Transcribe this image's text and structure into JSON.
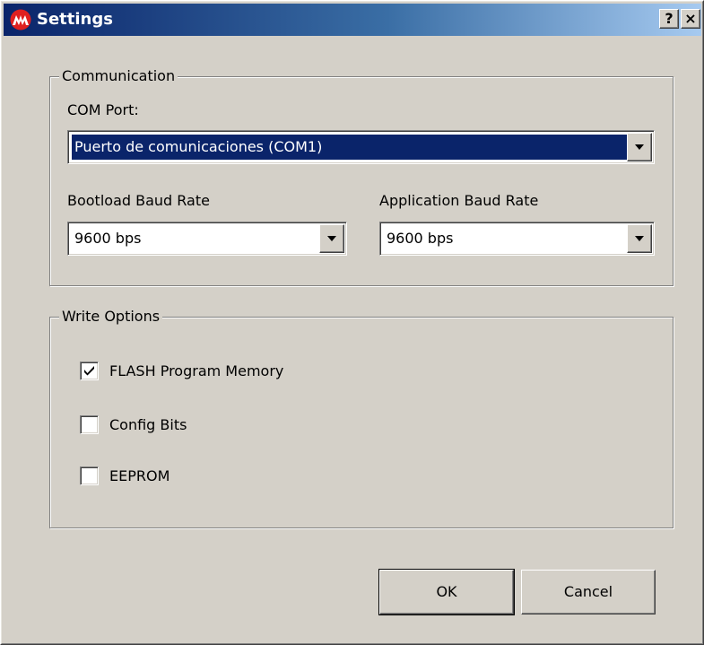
{
  "window": {
    "title": "Settings",
    "help_label": "?",
    "close_label": "×",
    "icon": "microchip-logo-icon",
    "accent_color": "#0a246a"
  },
  "communication": {
    "group_label": "Communication",
    "com_port_label": "COM Port:",
    "com_port_value": "Puerto de comunicaciones (COM1)",
    "bootload_label": "Bootload Baud Rate",
    "bootload_value": "9600 bps",
    "application_label": "Application Baud Rate",
    "application_value": "9600 bps"
  },
  "write_options": {
    "group_label": "Write Options",
    "items": [
      {
        "label": "FLASH Program Memory",
        "checked": true
      },
      {
        "label": "Config Bits",
        "checked": false
      },
      {
        "label": "EEPROM",
        "checked": false
      }
    ]
  },
  "buttons": {
    "ok_label": "OK",
    "cancel_label": "Cancel"
  }
}
